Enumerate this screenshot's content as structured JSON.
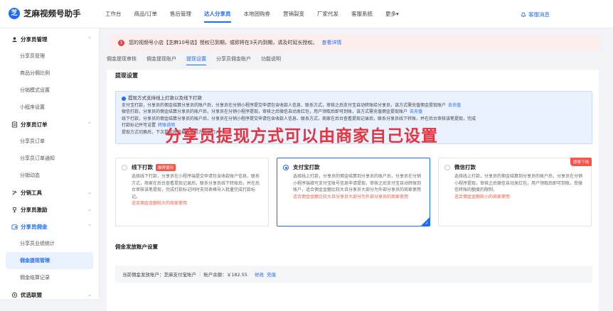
{
  "app": {
    "logo_glyph": "芝",
    "title": "芝麻视频号助手"
  },
  "nav": [
    {
      "label": "工作台",
      "active": false
    },
    {
      "label": "商品/订单",
      "active": false
    },
    {
      "label": "售后管理",
      "active": false
    },
    {
      "label": "达人分享员",
      "active": true
    },
    {
      "label": "本地团购券",
      "active": false
    },
    {
      "label": "营销裂变",
      "active": false
    },
    {
      "label": "厂家代发",
      "active": false
    },
    {
      "label": "客服系统",
      "active": false
    },
    {
      "label": "更多▾",
      "active": false
    }
  ],
  "service": {
    "icon": "bell-icon",
    "label": "客服消息"
  },
  "sidebar": [
    {
      "group": "分享员管理",
      "icon": "users-icon",
      "expanded": true,
      "items": [
        {
          "label": "分享员管理",
          "active": false
        },
        {
          "label": "商品分佣比例",
          "active": false
        },
        {
          "label": "分销模式设置",
          "active": false
        },
        {
          "label": "小程序设置",
          "active": false
        }
      ]
    },
    {
      "group": "分享员订单",
      "icon": "orders-icon",
      "expanded": true,
      "items": [
        {
          "label": "分享员订单",
          "active": false
        },
        {
          "label": "分享员订单通知",
          "active": false
        },
        {
          "label": "分销动态",
          "active": false
        }
      ]
    },
    {
      "group": "分销工具",
      "icon": "tools-icon",
      "expanded": false,
      "items": []
    },
    {
      "group": "分享员激励",
      "icon": "trophy-icon",
      "expanded": false,
      "items": []
    },
    {
      "group": "分享员佣金",
      "icon": "wallet-icon",
      "expanded": true,
      "items": [
        {
          "label": "分享员业绩统计",
          "active": false
        },
        {
          "label": "佣金提现管理",
          "active": true
        },
        {
          "label": "佣金结算记录",
          "active": false
        }
      ]
    },
    {
      "group": "优选联盟",
      "icon": "link-icon",
      "expanded": false,
      "items": []
    }
  ],
  "alert": {
    "icon": "error-icon",
    "text": "您的视频号小店【芝麻10号店】授权已到期，或即将在3天内到期，请及时延长授权。",
    "link": "查看详情"
  },
  "tabs": [
    {
      "label": "佣金提现审核",
      "active": false
    },
    {
      "label": "佣金提现账户",
      "active": false
    },
    {
      "label": "提现设置",
      "active": true
    },
    {
      "label": "分享员佣金账户",
      "active": false
    },
    {
      "label": "功能说明",
      "active": false
    }
  ],
  "withdraw": {
    "title": "提现设置",
    "info_head": "提现方式支持线上打款以及线下打款",
    "info_lines": [
      {
        "text": "支付宝打款，分享员的佣金结算分享员的账户后，分享员在分销小程序提交申请包含收款人信息、联系方式，审核之后支付宝自动转账给分享员，该方式需充值佣金提现账户",
        "link": "去充值"
      },
      {
        "text": "微信打款，分享员的佣金结算分享员的账户后，分享员在分销小程序提现，审核之后微信自动发红包，用户领取后即可到账，该方式需充值佣金提现账户",
        "link": "去充值"
      },
      {
        "text": "线下打款，分享员的佣金结算分享员的账户后，分享员在分销小程序提交申请包含收款人信息、联系方式，商家在后台查看提现记录后，联系分享员线下转账，并在后台审核该笔提现，完成",
        "link": ""
      },
      {
        "text": "打款标记并可设置",
        "link": "转账说明"
      },
      {
        "text": "提现方式切换后，下次提现将按最新提现方式执行。",
        "link": ""
      }
    ],
    "cards": [
      {
        "title": "线下打款",
        "badge": "推荐使用",
        "selected": false,
        "desc": "选择线下打款，分享员在小程序端提交申请包含收款账户信息、联系方式，商家在后台查看提现记录后，联系分享员线下转账后，并在后台审核该笔提现，完成打款标记同时支持表格导入批量完成打款标记。",
        "note": "适合佣金金额较大的商家使用"
      },
      {
        "title": "支付宝打款",
        "badge": "",
        "selected": true,
        "desc": "选择线上打款，分享员的佣金结算到分享员的账户后，分享员在分销小程序端填写支付宝账号信息申请提现，审核之后支付宝自动转账到账户，适合佣金金额比较大且分享员大部分为外部分享员的商家使用",
        "note": "适合佣金金额比较大且分享员大部分为外部分享员的商家使用"
      },
      {
        "title": "微信打款",
        "badge": "即将下线",
        "selected": false,
        "desc": "选择线上打款，分享员的佣金结算到分享员的账户后，分享员在分销小程序提现，审核之后微信自动发红包，用户领取后即可到账，受微信转账的额度的限制，",
        "note": "适合佣金金额较小的商家使用"
      }
    ]
  },
  "overlay": "分享员提现方式可以由商家自己设置",
  "account": {
    "section_title": "佣金发放账户设置",
    "label": "当前佣金发放账户：芝麻支付宝账户",
    "balance": "账户余额：￥182.55",
    "modify": "修改",
    "recharge": "充值"
  }
}
